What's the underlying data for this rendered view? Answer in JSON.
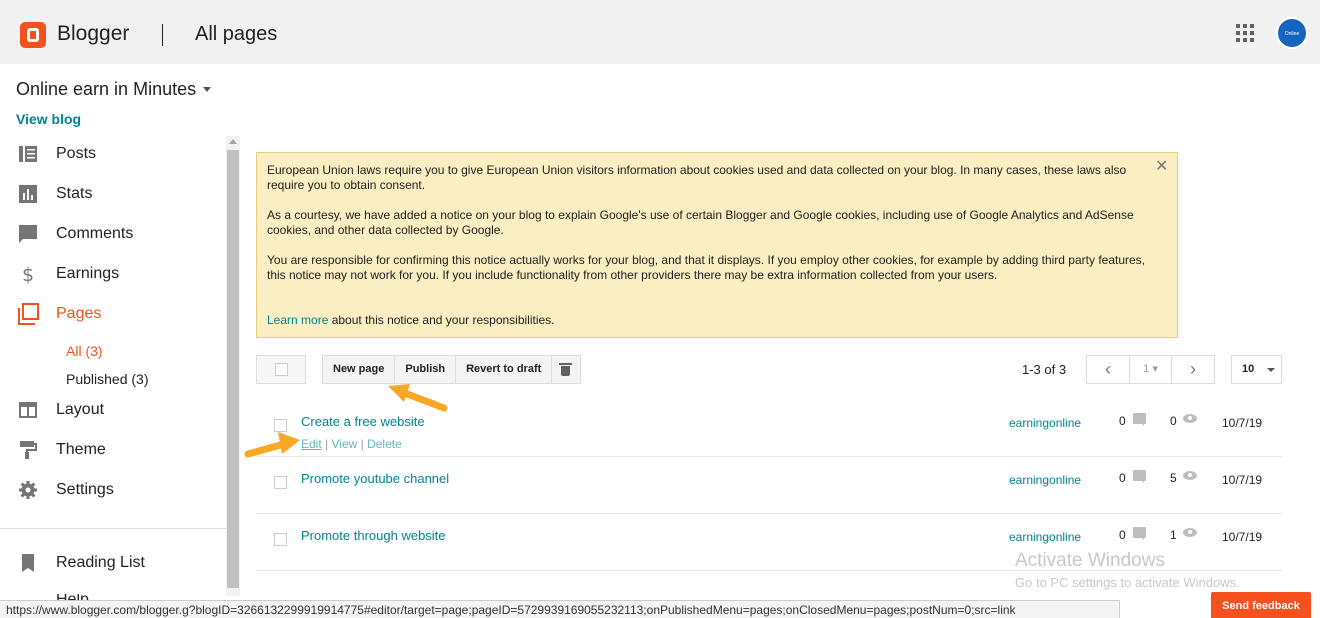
{
  "header": {
    "brand": "Blogger",
    "title": "All pages",
    "avatar_text": "Online Earning"
  },
  "sidebar": {
    "blog_name": "Online earn in Minutes",
    "view_blog": "View blog",
    "items": [
      {
        "label": "Posts",
        "icon": "posts-icon"
      },
      {
        "label": "Stats",
        "icon": "stats-icon"
      },
      {
        "label": "Comments",
        "icon": "comments-icon"
      },
      {
        "label": "Earnings",
        "icon": "dollar-icon"
      },
      {
        "label": "Pages",
        "icon": "pages-icon"
      },
      {
        "label": "Layout",
        "icon": "layout-icon"
      },
      {
        "label": "Theme",
        "icon": "paint-roller-icon"
      },
      {
        "label": "Settings",
        "icon": "gear-icon"
      },
      {
        "label": "Reading List",
        "icon": "bookmark-icon"
      },
      {
        "label": "Help",
        "icon": "help-icon"
      }
    ],
    "sub_items": [
      {
        "label": "All (3)"
      },
      {
        "label": "Published (3)"
      }
    ],
    "active_color": "#f4511e"
  },
  "notice": {
    "p1": "European Union laws require you to give European Union visitors information about cookies used and data collected on your blog. In many cases, these laws also require you to obtain consent.",
    "p2": "As a courtesy, we have added a notice on your blog to explain Google's use of certain Blogger and Google cookies, including use of Google Analytics and AdSense cookies, and other data collected by Google.",
    "p3": "You are responsible for confirming this notice actually works for your blog, and that it displays. If you employ other cookies, for example by adding third party features, this notice may not work for you. If you include functionality from other providers there may be extra information collected from your users.",
    "learn_more": "Learn more",
    "p4_rest": " about this notice and your responsibilities.",
    "close": "✕"
  },
  "toolbar": {
    "new_page": "New page",
    "publish": "Publish",
    "revert": "Revert to draft",
    "count": "1-3 of 3",
    "prev": "‹",
    "page": "1",
    "next": "›",
    "per_page": "10"
  },
  "pages": [
    {
      "title": "Create a free website",
      "edit": "Edit",
      "view": "View",
      "delete": "Delete",
      "author": "earningonline",
      "comments": "0",
      "views": "0",
      "date": "10/7/19"
    },
    {
      "title": "Promote youtube channel",
      "author": "earningonline",
      "comments": "0",
      "views": "5",
      "date": "10/7/19"
    },
    {
      "title": "Promote through website",
      "author": "earningonline",
      "comments": "0",
      "views": "1",
      "date": "10/7/19"
    }
  ],
  "watermark": {
    "line1": "Activate Windows",
    "line2": "Go to PC settings to activate Windows."
  },
  "statusbar": {
    "url": "https://www.blogger.com/blogger.g?blogID=3266132299919914775#editor/target=page;pageID=5729939169055232113;onPublishedMenu=pages;onClosedMenu=pages;postNum=0;src=link"
  },
  "feedback": "Send feedback",
  "colors": {
    "accent": "#f4511e",
    "link": "#00838f",
    "notice_bg": "#fbeec2",
    "arrow": "#f9a825"
  }
}
